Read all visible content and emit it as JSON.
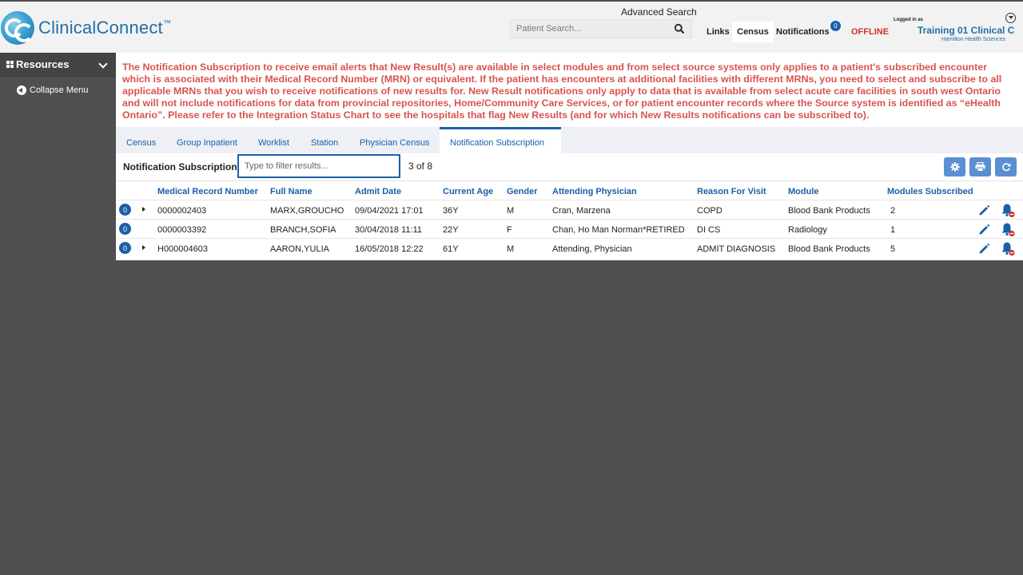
{
  "header": {
    "logo_text": "ClinicalConnect",
    "logo_tm": "™",
    "advanced_search": "Advanced Search",
    "search_placeholder": "Patient Search...",
    "links": "Links",
    "census": "Census",
    "notifications": "Notifications",
    "notifications_count": "0",
    "status": "OFFLINE",
    "logged_in_as": "Logged in as",
    "user_name": "Training 01 Clinical C",
    "user_org": "Hamilton Health Sciences"
  },
  "sidebar": {
    "resources_label": "Resources",
    "collapse_label": "Collapse Menu"
  },
  "notice": "The Notification Subscription to receive email alerts that New Result(s) are available in select modules and from select source systems only applies to a patient's subscribed encounter which is associated with their Medical Record Number (MRN) or equivalent. If the patient has encounters at additional facilities with different MRNs, you need to select and subscribe to all applicable MRNs that you wish to receive notifications of new results for. New Result notifications only apply to data that is available from select acute care facilities in south west Ontario and will not include notifications for data from provincial repositories, Home/Community Care Services, or for patient encounter records where the Source system is identified as “eHealth Ontario”. Please refer to the Integration Status Chart to see the hospitals that flag New Results (and for which New Results notifications can be subscribed to).",
  "tabs": [
    {
      "label": "Census"
    },
    {
      "label": "Group Inpatient"
    },
    {
      "label": "Worklist"
    },
    {
      "label": "Station"
    },
    {
      "label": "Physician Census"
    },
    {
      "label": "Notification Subscription"
    }
  ],
  "panel": {
    "title": "Notification Subscription",
    "filter_placeholder": "Type to filter results...",
    "count": "3 of 8"
  },
  "table": {
    "columns": [
      "Medical Record Number",
      "Full Name",
      "Admit Date",
      "Current Age",
      "Gender",
      "Attending Physician",
      "Reason For Visit",
      "Module",
      "Modules Subscribed"
    ],
    "rows": [
      {
        "badge": "0",
        "mrn": "0000002403",
        "name": "MARX,GROUCHO",
        "admit": "09/04/2021 17:01",
        "age": "36Y",
        "gender": "M",
        "physician": "Cran, Marzena",
        "reason": "COPD",
        "module": "Blood Bank Products",
        "subscribed": "2"
      },
      {
        "badge": "0",
        "mrn": "0000003392",
        "name": "BRANCH,SOFIA",
        "admit": "30/04/2018 11:11",
        "age": "22Y",
        "gender": "F",
        "physician": "Chan, Ho Man Norman*RETIRED",
        "reason": "DI CS",
        "module": "Radiology",
        "subscribed": "1"
      },
      {
        "badge": "0",
        "mrn": "H000004603",
        "name": "AARON,YULIA",
        "admit": "16/05/2018 12:22",
        "age": "61Y",
        "gender": "M",
        "physician": "Attending, Physician",
        "reason": "ADMIT DIAGNOSIS",
        "module": "Blood Bank Products",
        "subscribed": "5"
      }
    ]
  },
  "colors": {
    "brand_blue": "#1a5fa8",
    "notice_red": "#d9534f",
    "offline_red": "#d0312d",
    "tool_button": "#5b8fd1"
  }
}
